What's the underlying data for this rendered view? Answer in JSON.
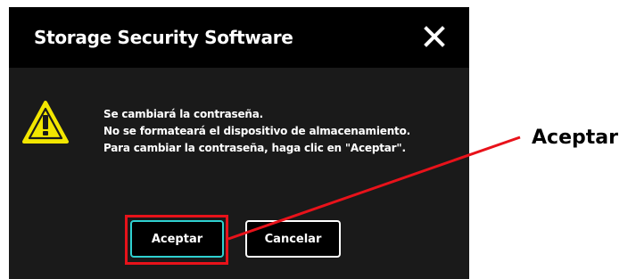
{
  "dialog": {
    "title": "Storage Security Software",
    "message_lines": [
      "Se cambiará la contraseña.",
      "No se formateará el dispositivo de almacenamiento.",
      "Para cambiar la contraseña, haga clic en \"Aceptar\"."
    ],
    "ok_label": "Aceptar",
    "cancel_label": "Cancelar",
    "close_icon": "close-icon",
    "warning_icon": "warning-icon"
  },
  "annotation": {
    "callout_label": "Aceptar",
    "highlight_color": "#e8121a"
  },
  "colors": {
    "titlebar": "#000000",
    "dialog_bg": "#1a1a1a",
    "ok_border": "#2fd0d0",
    "warning_yellow": "#f2e600"
  }
}
